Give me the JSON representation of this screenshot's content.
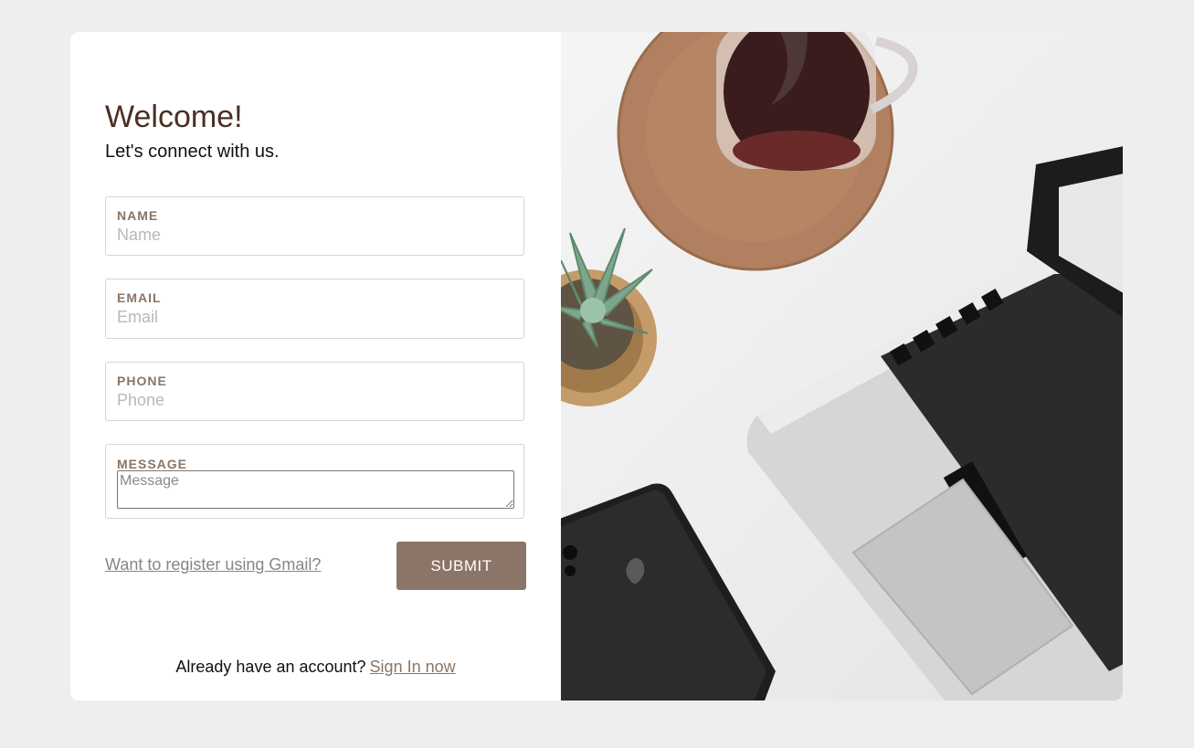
{
  "header": {
    "title": "Welcome!",
    "subtitle": "Let's connect with us."
  },
  "form": {
    "name": {
      "label": "NAME",
      "placeholder": "Name"
    },
    "email": {
      "label": "EMAIL",
      "placeholder": "Email"
    },
    "phone": {
      "label": "PHONE",
      "placeholder": "Phone"
    },
    "message": {
      "label": "MESSAGE",
      "placeholder": "Message"
    },
    "gmail_link": "Want to register using Gmail?",
    "submit_label": "SUBMIT"
  },
  "footer": {
    "prompt": "Already have an account?",
    "signin_link": "Sign In now"
  },
  "colors": {
    "background": "#efeded",
    "accent": "#8b7568",
    "title": "#4a2f22",
    "label": "#8a7566"
  },
  "photo": {
    "description_icon": "desk-photo-icon"
  }
}
